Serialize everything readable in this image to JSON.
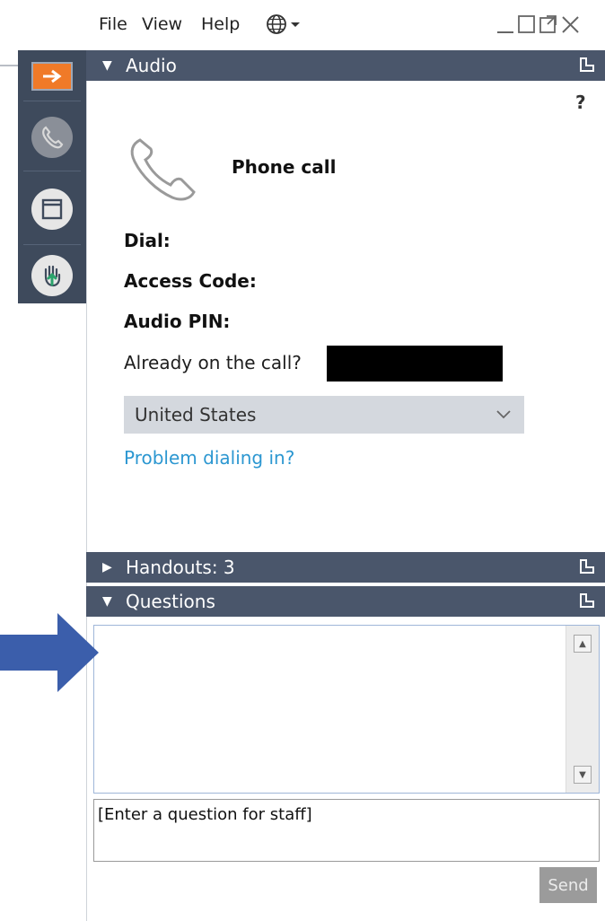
{
  "menu": {
    "file": "File",
    "view": "View",
    "help": "Help"
  },
  "window_controls": [
    "minimize",
    "restore",
    "popout",
    "close"
  ],
  "toolbar": {
    "items": [
      "arrow-right-icon",
      "phone-icon",
      "window-icon",
      "raise-hand-icon"
    ],
    "accent_color": "#f07a28"
  },
  "audio": {
    "header": "Audio",
    "help_mark": "?",
    "mode": "Phone call",
    "dial_label": "Dial:",
    "access_code_label": "Access Code:",
    "audio_pin_label": "Audio PIN:",
    "already_on_call": "Already on the call?",
    "country": "United States",
    "problem_link": "Problem dialing in?"
  },
  "handouts": {
    "header": "Handouts: 3"
  },
  "questions": {
    "header": "Questions",
    "placeholder": "[Enter a question for staff]",
    "send_label": "Send"
  },
  "colors": {
    "header_bg": "#4a566b",
    "toolbar_bg": "#3e4a5c",
    "link": "#2c97d1",
    "arrow": "#3b5eab"
  }
}
